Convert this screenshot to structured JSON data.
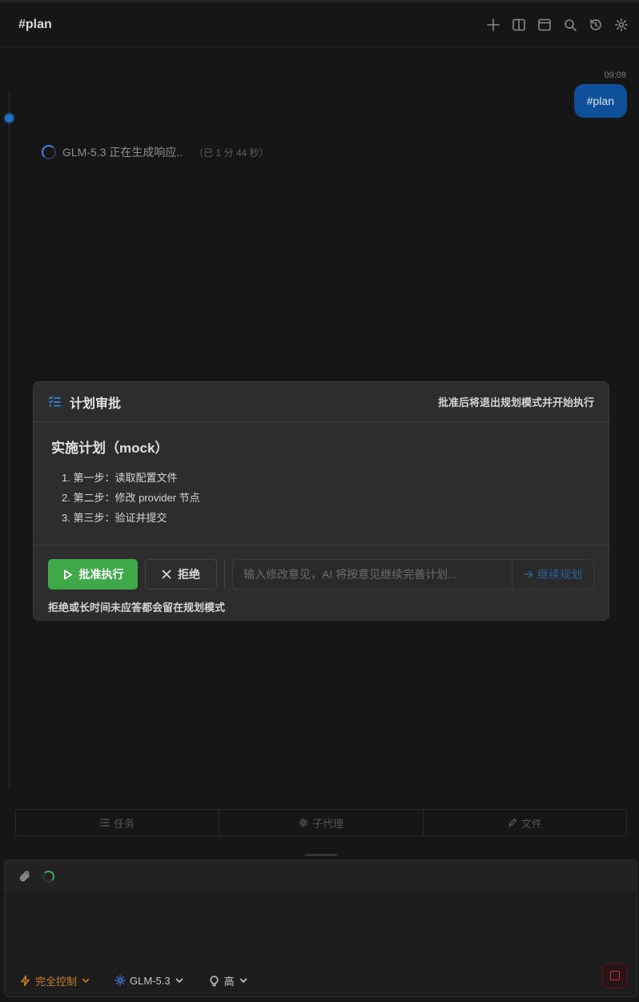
{
  "header": {
    "title": "#plan"
  },
  "message": {
    "time": "09:09",
    "text": "#plan"
  },
  "status": {
    "text": "GLM-5.3 正在生成响应..",
    "elapsed": "（已 1 分 44 秒）"
  },
  "plan_card": {
    "title": "计划审批",
    "hint": "批准后将退出规划模式并开始执行",
    "heading": "实施计划（mock）",
    "steps": [
      "1. 第一步：读取配置文件",
      "2. 第二步：修改 provider 节点",
      "3. 第三步：验证并提交"
    ],
    "approve_label": "批准执行",
    "reject_label": "拒绝",
    "feedback_placeholder": "输入修改意见，AI 将按意见继续完善计划...",
    "continue_label": "继续规划",
    "footer_note": "拒绝或长时间未应答都会留在规划模式"
  },
  "bottom_tabs": [
    {
      "label": "任务",
      "icon": "list-icon"
    },
    {
      "label": "子代理",
      "icon": "gear-icon"
    },
    {
      "label": "文件",
      "icon": "pencil-icon"
    }
  ],
  "composer": {
    "mode_label": "完全控制",
    "model_label": "GLM-5.3",
    "effort_label": "高"
  },
  "colors": {
    "accent_blue": "#1e6fc4",
    "approve_green": "#3fa94a",
    "mode_orange": "#c87b22",
    "stop_red": "#c43232"
  }
}
